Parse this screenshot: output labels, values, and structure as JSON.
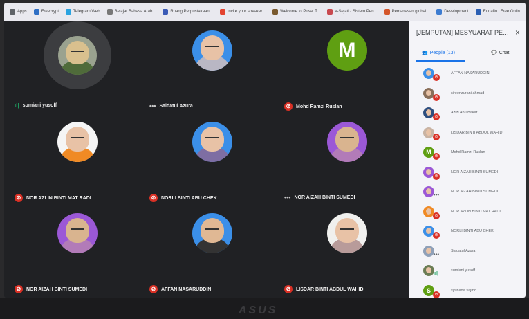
{
  "bookmarks": [
    {
      "label": "Apps",
      "color": "#5f6368"
    },
    {
      "label": "Freecrypt",
      "color": "#2f6fc4"
    },
    {
      "label": "Telegram Web",
      "color": "#2aa3e0"
    },
    {
      "label": "Belajar Bahasa Arab...",
      "color": "#777777"
    },
    {
      "label": "Ruang Perpustakaan...",
      "color": "#3b5bb6"
    },
    {
      "label": "Invite your speaker...",
      "color": "#e3432f"
    },
    {
      "label": "Welcome to Pusat T...",
      "color": "#7a5a2f"
    },
    {
      "label": "e-Sejati - Sistem Pen...",
      "color": "#c8494f"
    },
    {
      "label": "Pemanasan global...",
      "color": "#d4562b"
    },
    {
      "label": "Development",
      "color": "#3c7bd0"
    },
    {
      "label": "Eudaflo | Free Onlin...",
      "color": "#2b5fb3"
    }
  ],
  "grid": {
    "tiles": [
      {
        "name": "sumiani yusoff",
        "status": "speaking",
        "status_text": "ıl|",
        "avatar": "photo",
        "colors": [
          "#9aa28f",
          "#4f6b3a",
          "#d9c08e"
        ]
      },
      {
        "name": "Saidatul Azura",
        "status": "dots",
        "status_text": "•••",
        "avatar": "photo",
        "colors": [
          "#3b8fe8",
          "#b9b7c4",
          "#e8c2a6"
        ]
      },
      {
        "name": "Mohd Ramzi Ruslan",
        "status": "muted",
        "status_text": "🎤",
        "avatar": "letter",
        "letter": "M",
        "colors": [
          "#5f9f12"
        ]
      },
      {
        "name": "NOR AZLIN BINTI MAT RADI",
        "status": "muted",
        "status_text": "🎤",
        "avatar": "photo",
        "colors": [
          "#f5f5f5",
          "#f08a24",
          "#e8c2a6"
        ]
      },
      {
        "name": "NORLI BINTI ABU CHEK",
        "status": "muted",
        "status_text": "🎤",
        "avatar": "photo",
        "colors": [
          "#3b8fe8",
          "#7e6ea3",
          "#e8c2a6"
        ]
      },
      {
        "name": "NOR AIZAH BINTI SUMEDI",
        "status": "dots",
        "status_text": "•••",
        "avatar": "photo",
        "colors": [
          "#9b58d6",
          "#b27bb8",
          "#d9b48f"
        ]
      },
      {
        "name": "NOR AIZAH BINTI SUMEDI",
        "status": "muted",
        "status_text": "🎤",
        "avatar": "photo",
        "colors": [
          "#9b58d6",
          "#b27bb8",
          "#d9b48f"
        ]
      },
      {
        "name": "AFFAN NASARUDDIN",
        "status": "muted",
        "status_text": "🎤",
        "avatar": "photo",
        "colors": [
          "#3b8fe8",
          "#333333",
          "#e0b894"
        ]
      },
      {
        "name": "LISDAR BINTI ABDUL WAHID",
        "status": "muted",
        "status_text": "🎤",
        "avatar": "photo",
        "colors": [
          "#f0f0ee",
          "#b89b9a",
          "#e8c2a6"
        ]
      }
    ]
  },
  "sidebar": {
    "title": "[JEMPUTAN] MESYUARAT PENYE...",
    "close_icon": "×",
    "people_tab": "People (13)",
    "chat_tab": "Chat",
    "participants": [
      {
        "name": "AFFAN NASARUDDIN",
        "status_text": "🎤",
        "status": "muted",
        "color": "#3b8fe8"
      },
      {
        "name": "sireenzurani ahmad",
        "status_text": "🎤",
        "status": "muted",
        "color": "#8a6f5a"
      },
      {
        "name": "Azizi Abu Bakar",
        "status_text": "🎤",
        "status": "muted",
        "color": "#2f4f7f"
      },
      {
        "name": "LISDAR BINTI ABDUL WAHID",
        "status_text": "🎤",
        "status": "muted",
        "color": "#c9b3a3"
      },
      {
        "name": "Mohd Ramzi Ruslan",
        "status_text": "🎤",
        "status": "muted",
        "color": "#5f9f12",
        "letter": "M"
      },
      {
        "name": "NOR AIZAH BINTI SUMEDI",
        "status_text": "🎤",
        "status": "muted",
        "color": "#9b58d6"
      },
      {
        "name": "NOR AIZAH BINTI SUMEDI",
        "status_text": "•••",
        "status": "dots",
        "color": "#9b58d6"
      },
      {
        "name": "NOR AZLIN BINTI MAT RADI",
        "status_text": "🎤",
        "status": "muted",
        "color": "#f08a24"
      },
      {
        "name": "NORLI BINTI ABU CHEK",
        "status_text": "🎤",
        "status": "muted",
        "color": "#3b8fe8"
      },
      {
        "name": "Saidatul Azura",
        "status_text": "•••",
        "status": "dots",
        "color": "#8fa0b8"
      },
      {
        "name": "sumiani yusoff",
        "status_text": "ıl|",
        "status": "speaking",
        "color": "#6b7d55"
      },
      {
        "name": "syuhada sajmo",
        "status_text": "🎤",
        "status": "muted",
        "color": "#5f9f12",
        "letter": "S"
      }
    ]
  },
  "laptop": {
    "brand": "ASUS"
  }
}
